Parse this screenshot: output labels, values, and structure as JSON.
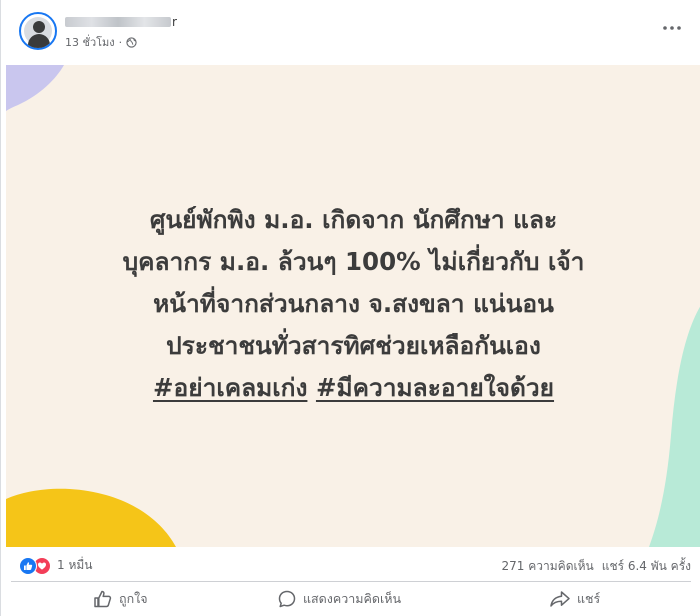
{
  "post": {
    "author": {
      "name_visible_tail": "r"
    },
    "time": "13 ชั่วโมง",
    "audience_icon": "globe-icon",
    "more_icon": "more-options-icon"
  },
  "card": {
    "lines": [
      "ศูนย์พักพิง ม.อ. เกิดจาก นักศึกษา และ",
      "บุคลากร ม.อ. ล้วนๆ 100% ไม่เกี่ยวกับ เจ้า",
      "หน้าที่จากส่วนกลาง จ.สงขลา แน่นอน",
      "ประชาชนทั่วสารทิศช่วยเหลือกันเอง"
    ],
    "hashtags": [
      "#อย่าเคลมเก่ง",
      "#มีความละอายใจด้วย"
    ],
    "colors": {
      "background": "#f9f1e7",
      "text": "#3c3c3c"
    }
  },
  "stats": {
    "reaction_count": "1 หมื่น",
    "comments": "271 ความคิดเห็น",
    "shares": "แชร์ 6.4 พัน ครั้ง"
  },
  "actions": {
    "like": "ถูกใจ",
    "comment": "แสดงความคิดเห็น",
    "share": "แชร์"
  },
  "colors": {
    "accent": "#1877f2",
    "love": "#f33e58",
    "secondary_text": "#65676b"
  }
}
